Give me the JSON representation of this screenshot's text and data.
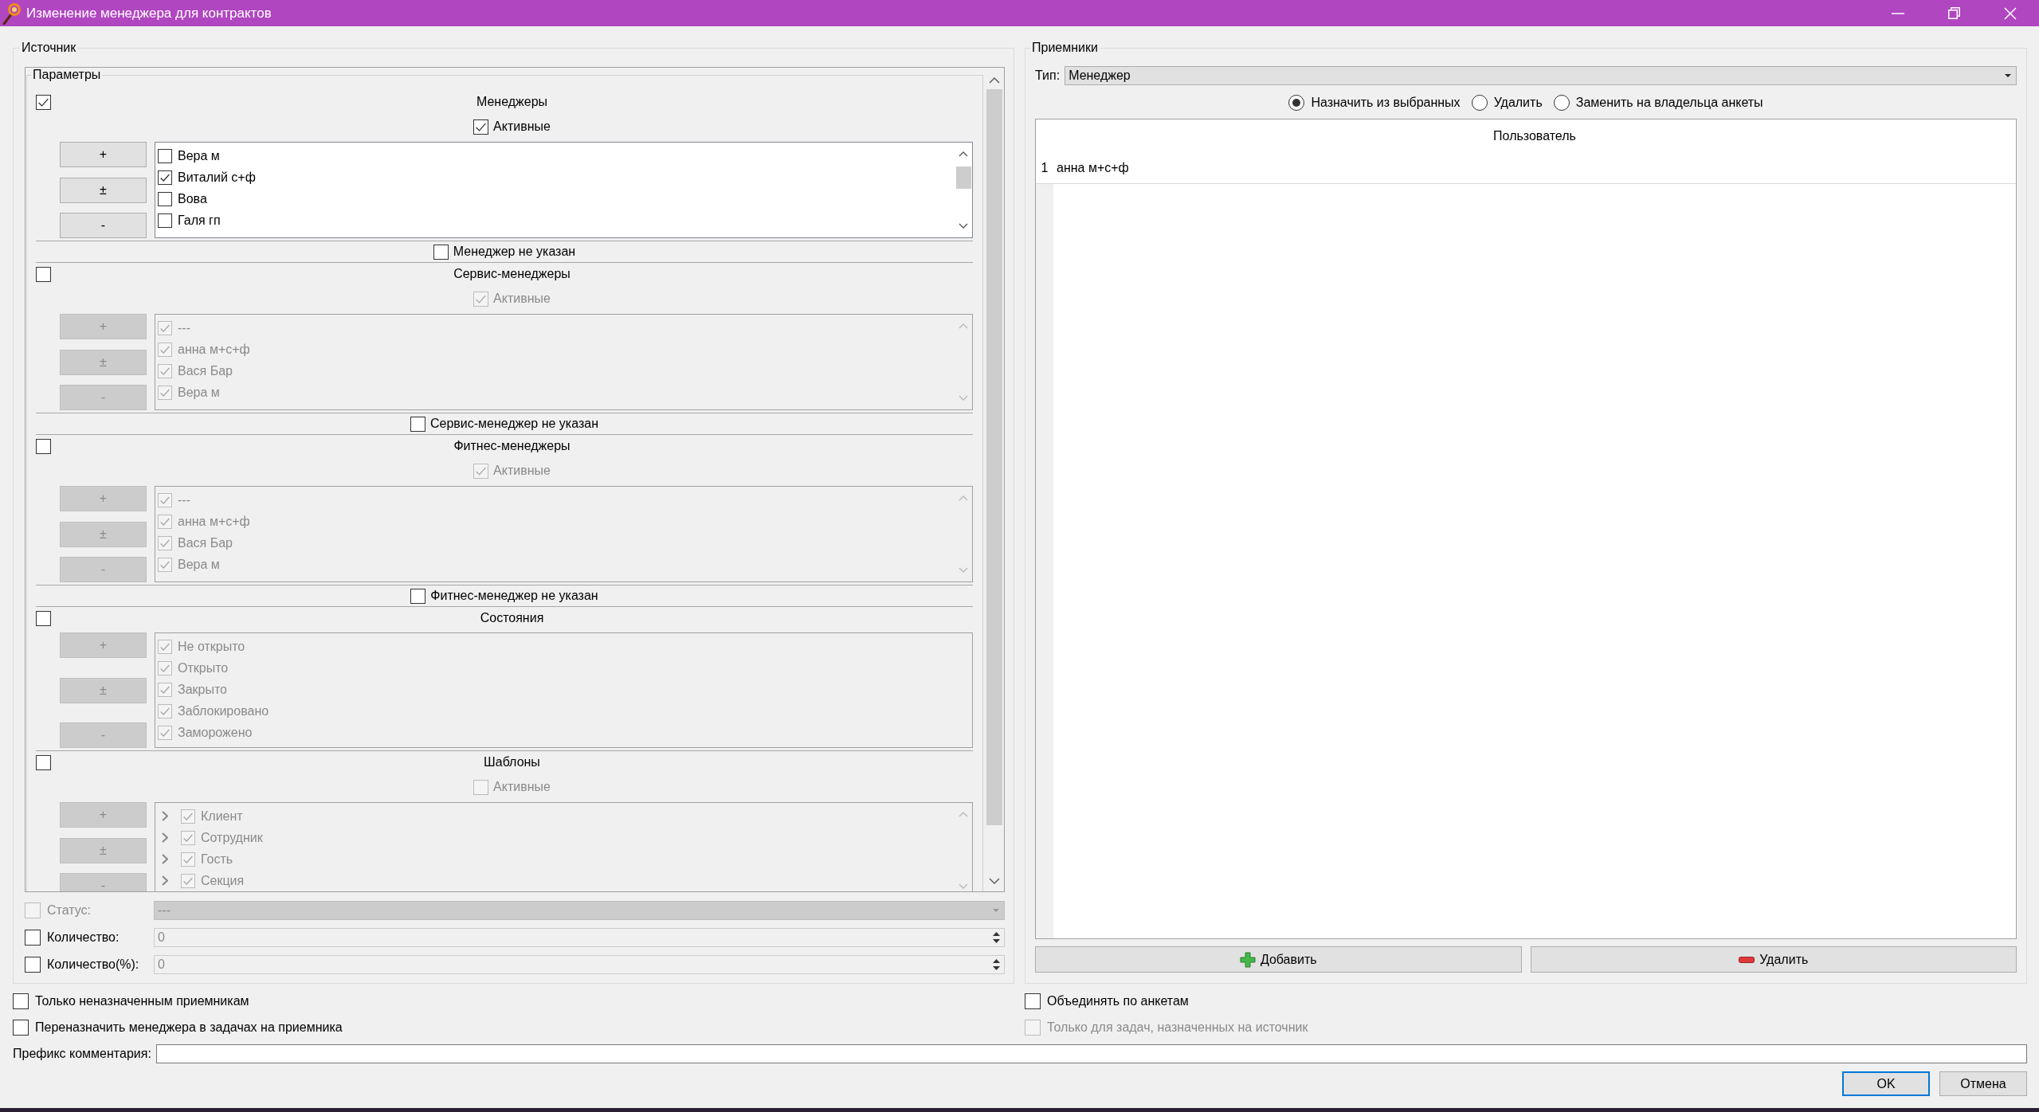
{
  "window": {
    "title": "Изменение менеджера для контрактов"
  },
  "source": {
    "title": "Источник",
    "parameters": {
      "title": "Параметры",
      "sections": [
        {
          "kind": "list",
          "title": "Менеджеры",
          "checked": true,
          "active": {
            "label": "Активные",
            "checked": true
          },
          "buttons": [
            "+",
            "±",
            "-"
          ],
          "items": [
            {
              "label": "Вера м",
              "checked": false
            },
            {
              "label": "Виталий с+ф",
              "checked": true
            },
            {
              "label": "Вова",
              "checked": false
            },
            {
              "label": "Галя гп",
              "checked": false
            }
          ],
          "unassigned": {
            "label": "Менеджер не указан",
            "checked": false
          }
        },
        {
          "kind": "list",
          "title": "Сервис-менеджеры",
          "checked": false,
          "active": {
            "label": "Активные",
            "checked": true
          },
          "buttons": [
            "+",
            "±",
            "-"
          ],
          "items": [
            {
              "label": "---",
              "checked": true
            },
            {
              "label": "анна м+с+ф",
              "checked": true
            },
            {
              "label": "Вася Бар",
              "checked": true
            },
            {
              "label": "Вера м",
              "checked": true
            }
          ],
          "unassigned": {
            "label": "Сервис-менеджер не указан",
            "checked": false
          }
        },
        {
          "kind": "list",
          "title": "Фитнес-менеджеры",
          "checked": false,
          "active": {
            "label": "Активные",
            "checked": true
          },
          "buttons": [
            "+",
            "±",
            "-"
          ],
          "items": [
            {
              "label": "---",
              "checked": true
            },
            {
              "label": "анна м+с+ф",
              "checked": true
            },
            {
              "label": "Вася Бар",
              "checked": true
            },
            {
              "label": "Вера м",
              "checked": true
            }
          ],
          "unassigned": {
            "label": "Фитнес-менеджер не указан",
            "checked": false
          }
        },
        {
          "kind": "plain",
          "title": "Состояния",
          "checked": false,
          "buttons": [
            "+",
            "±",
            "-"
          ],
          "items": [
            {
              "label": "Не открыто",
              "checked": true
            },
            {
              "label": "Открыто",
              "checked": true
            },
            {
              "label": "Закрыто",
              "checked": true
            },
            {
              "label": "Заблокировано",
              "checked": true
            },
            {
              "label": "Заморожено",
              "checked": true
            }
          ]
        },
        {
          "kind": "tree",
          "title": "Шаблоны",
          "checked": false,
          "active": {
            "label": "Активные",
            "checked": false
          },
          "buttons": [
            "+",
            "±",
            "-"
          ],
          "items": [
            {
              "label": "Клиент",
              "checked": true,
              "expanded": false
            },
            {
              "label": "Сотрудник",
              "checked": true,
              "expanded": false
            },
            {
              "label": "Гость",
              "checked": true,
              "expanded": false
            },
            {
              "label": "Секция",
              "checked": true,
              "expanded": false
            }
          ]
        }
      ]
    },
    "filters": [
      {
        "kind": "combo",
        "label": "Статус:",
        "checked": false,
        "disabled": true,
        "value": "---"
      },
      {
        "kind": "spin",
        "label": "Количество:",
        "checked": false,
        "disabled": false,
        "value": "0"
      },
      {
        "kind": "spin",
        "label": "Количество(%):",
        "checked": false,
        "disabled": false,
        "value": "0"
      }
    ]
  },
  "receivers": {
    "title": "Приемники",
    "type": {
      "label": "Тип:",
      "value": "Менеджер"
    },
    "modes": [
      {
        "label": "Назначить из выбранных",
        "selected": true
      },
      {
        "label": "Удалить",
        "selected": false
      },
      {
        "label": "Заменить на владельца анкеты",
        "selected": false
      }
    ],
    "table": {
      "columns": [
        "Пользователь"
      ],
      "rows": [
        {
          "number": "1",
          "cells": [
            "анна м+с+ф"
          ]
        }
      ]
    },
    "buttons": [
      {
        "kind": "add",
        "label": "Добавить"
      },
      {
        "kind": "remove",
        "label": "Удалить"
      }
    ]
  },
  "source_options": [
    {
      "label": "Только неназначенным приемникам",
      "checked": false
    },
    {
      "label": "Переназначить менеджера в задачах на приемника",
      "checked": false
    }
  ],
  "receiver_options": [
    {
      "label": "Объединять по анкетам",
      "checked": false,
      "disabled": false
    },
    {
      "label": "Только для задач, назначенных на источник",
      "checked": false,
      "disabled": true
    }
  ],
  "comment_prefix": {
    "label": "Префикс комментария:"
  },
  "dialog_buttons": [
    {
      "label": "OK",
      "default": true
    },
    {
      "label": "Отмена",
      "default": false
    }
  ]
}
